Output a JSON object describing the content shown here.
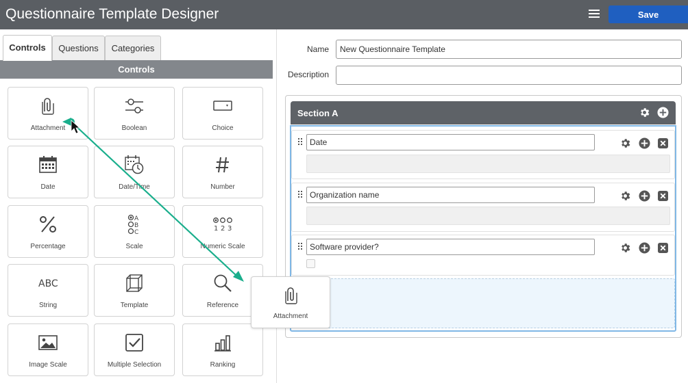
{
  "header": {
    "title": "Questionnaire Template Designer",
    "save_label": "Save"
  },
  "tabs": [
    {
      "label": "Controls",
      "active": true
    },
    {
      "label": "Questions"
    },
    {
      "label": "Categories"
    }
  ],
  "controls_title": "Controls",
  "controls": [
    {
      "label": "Attachment",
      "icon": "paperclip-icon"
    },
    {
      "label": "Boolean",
      "icon": "toggle-sliders-icon"
    },
    {
      "label": "Choice",
      "icon": "dropdown-select-icon"
    },
    {
      "label": "Date",
      "icon": "calendar-icon"
    },
    {
      "label": "Date/Time",
      "icon": "calendar-clock-icon"
    },
    {
      "label": "Number",
      "icon": "hash-icon"
    },
    {
      "label": "Percentage",
      "icon": "percent-icon"
    },
    {
      "label": "Scale",
      "icon": "abc-scale-icon"
    },
    {
      "label": "Numeric Scale",
      "icon": "numeric-scale-icon"
    },
    {
      "label": "String",
      "icon": "abc-text-icon"
    },
    {
      "label": "Template",
      "icon": "cube-icon"
    },
    {
      "label": "Reference",
      "icon": "magnifier-icon"
    },
    {
      "label": "Image Scale",
      "icon": "image-icon"
    },
    {
      "label": "Multiple Selection",
      "icon": "checkbox-icon"
    },
    {
      "label": "Ranking",
      "icon": "bar-ranking-icon"
    }
  ],
  "form": {
    "name_label": "Name",
    "name_value": "New Questionnaire Template",
    "description_label": "Description",
    "description_value": ""
  },
  "section": {
    "title": "Section A",
    "questions": [
      {
        "value": "Date"
      },
      {
        "value": "Organization name"
      },
      {
        "value": "Software provider?"
      }
    ]
  },
  "drag_ghost": {
    "label": "Attachment",
    "icon": "paperclip-icon"
  },
  "colors": {
    "header": "#5a5e63",
    "save": "#1f5fc0",
    "accent_arrow": "#1aae8c",
    "section_border": "#7fb7e6"
  }
}
